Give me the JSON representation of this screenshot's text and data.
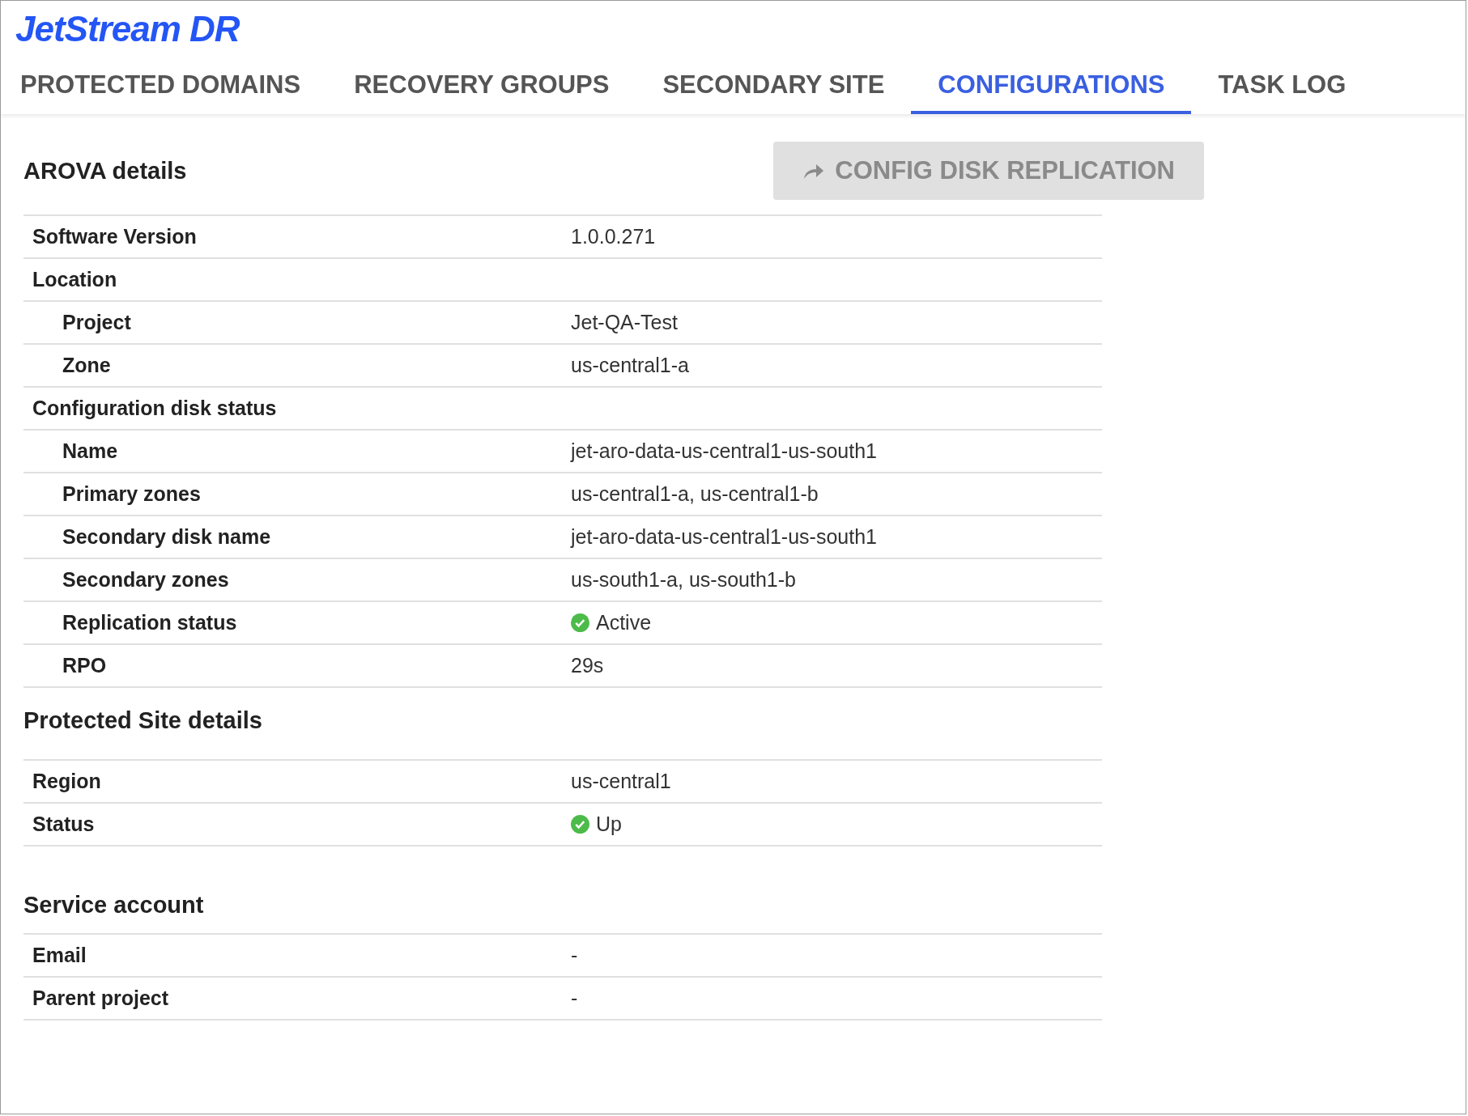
{
  "app": {
    "logo": "JetStream DR"
  },
  "tabs": [
    {
      "label": "PROTECTED DOMAINS",
      "selected": false
    },
    {
      "label": "RECOVERY GROUPS",
      "selected": false
    },
    {
      "label": "SECONDARY SITE",
      "selected": false
    },
    {
      "label": "CONFIGURATIONS",
      "selected": true
    },
    {
      "label": "TASK LOG",
      "selected": false
    }
  ],
  "sections": [
    {
      "title": "AROVA details",
      "action": {
        "label": "CONFIG DISK REPLICATION",
        "disabled": true
      },
      "rows": [
        {
          "label": "Software Version",
          "value": "1.0.0.271"
        },
        {
          "label": "Location",
          "children": [
            {
              "label": "Project",
              "value": "Jet-QA-Test"
            },
            {
              "label": "Zone",
              "value": "us-central1-a"
            }
          ]
        },
        {
          "label": "Configuration disk status",
          "children": [
            {
              "label": "Name",
              "value": "jet-aro-data-us-central1-us-south1"
            },
            {
              "label": "Primary zones",
              "value": "us-central1-a, us-central1-b"
            },
            {
              "label": "Secondary disk name",
              "value": "jet-aro-data-us-central1-us-south1"
            },
            {
              "label": "Secondary zones",
              "value": "us-south1-a, us-south1-b"
            },
            {
              "label": "Replication status",
              "value": "Active",
              "kind": "status"
            },
            {
              "label": "RPO",
              "value": "29s"
            }
          ]
        }
      ]
    },
    {
      "title": "Protected Site details",
      "rows": [
        {
          "label": "Region",
          "value": "us-central1"
        },
        {
          "label": "Status",
          "value": "Up",
          "kind": "status"
        }
      ]
    },
    {
      "title": "Service account",
      "gap": true,
      "rows": [
        {
          "label": "Email",
          "value": "-"
        },
        {
          "label": "Parent project",
          "value": "-"
        }
      ]
    }
  ]
}
